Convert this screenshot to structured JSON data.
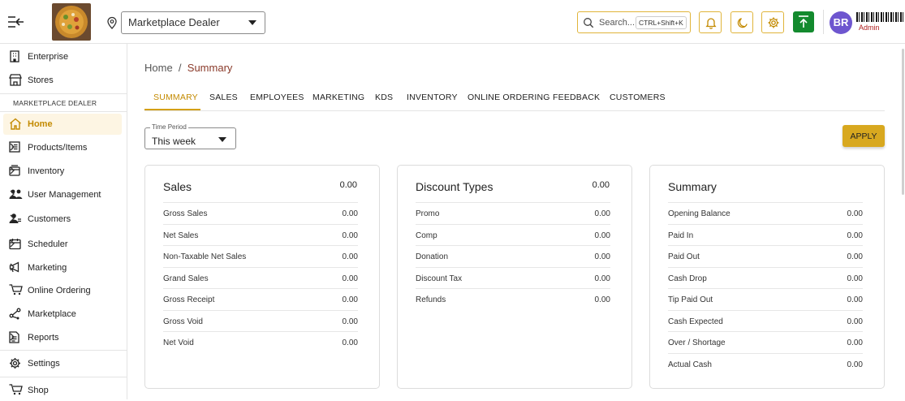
{
  "header": {
    "store_selected": "Marketplace Dealer",
    "search_placeholder": "Search...",
    "search_shortcut": "CTRL+Shift+K",
    "avatar_initials": "BR",
    "user_role": "Admin",
    "accent_color": "#d8a81f",
    "upload_color": "#138a2e",
    "avatar_color": "#6e56cf"
  },
  "sidebar": {
    "top_items": [
      {
        "label": "Enterprise",
        "icon": "building-icon"
      },
      {
        "label": "Stores",
        "icon": "store-icon"
      }
    ],
    "section_label": "MARKETPLACE DEALER",
    "items": [
      {
        "label": "Home",
        "icon": "home-icon",
        "active": true
      },
      {
        "label": "Products/Items",
        "icon": "list-icon",
        "chevron": true
      },
      {
        "label": "Inventory",
        "icon": "box-icon",
        "chevron": true
      },
      {
        "label": "User Management",
        "icon": "users-icon",
        "chevron": true
      },
      {
        "label": "Customers",
        "icon": "customers-icon",
        "chevron": true
      },
      {
        "label": "Scheduler",
        "icon": "calendar-icon",
        "chevron": true
      },
      {
        "label": "Marketing",
        "icon": "megaphone-icon",
        "chevron": true
      },
      {
        "label": "Online Ordering",
        "icon": "cart-icon"
      },
      {
        "label": "Marketplace",
        "icon": "share-icon"
      },
      {
        "label": "Reports",
        "icon": "report-icon",
        "chevron": true
      }
    ],
    "bottom_items": [
      {
        "label": "Settings",
        "icon": "gear-icon"
      },
      {
        "label": "Shop",
        "icon": "shop-cart-icon"
      }
    ]
  },
  "breadcrumb": {
    "home": "Home",
    "separator": "/",
    "current": "Summary"
  },
  "tabs": [
    "SUMMARY",
    "SALES",
    "EMPLOYEES",
    "MARKETING",
    "KDS",
    "INVENTORY",
    "ONLINE ORDERING",
    "FEEDBACK",
    "CUSTOMERS"
  ],
  "active_tab": "SUMMARY",
  "filter": {
    "label": "Time Period",
    "value": "This week",
    "apply_label": "APPLY"
  },
  "cards": [
    {
      "title": "Sales",
      "total": "0.00",
      "rows": [
        {
          "label": "Gross Sales",
          "value": "0.00"
        },
        {
          "label": "Net Sales",
          "value": "0.00"
        },
        {
          "label": "Non-Taxable Net Sales",
          "value": "0.00"
        },
        {
          "label": "Grand Sales",
          "value": "0.00"
        },
        {
          "label": "Gross Receipt",
          "value": "0.00"
        },
        {
          "label": "Gross Void",
          "value": "0.00"
        },
        {
          "label": "Net Void",
          "value": "0.00"
        }
      ]
    },
    {
      "title": "Discount Types",
      "total": "0.00",
      "rows": [
        {
          "label": "Promo",
          "value": "0.00"
        },
        {
          "label": "Comp",
          "value": "0.00"
        },
        {
          "label": "Donation",
          "value": "0.00"
        },
        {
          "label": "Discount Tax",
          "value": "0.00"
        },
        {
          "label": "Refunds",
          "value": "0.00"
        }
      ]
    },
    {
      "title": "Summary",
      "total": "",
      "rows": [
        {
          "label": "Opening Balance",
          "value": "0.00"
        },
        {
          "label": "Paid In",
          "value": "0.00"
        },
        {
          "label": "Paid Out",
          "value": "0.00"
        },
        {
          "label": "Cash Drop",
          "value": "0.00"
        },
        {
          "label": "Tip Paid Out",
          "value": "0.00"
        },
        {
          "label": "Cash Expected",
          "value": "0.00"
        },
        {
          "label": "Over / Shortage",
          "value": "0.00"
        },
        {
          "label": "Actual Cash",
          "value": "0.00"
        }
      ]
    }
  ]
}
